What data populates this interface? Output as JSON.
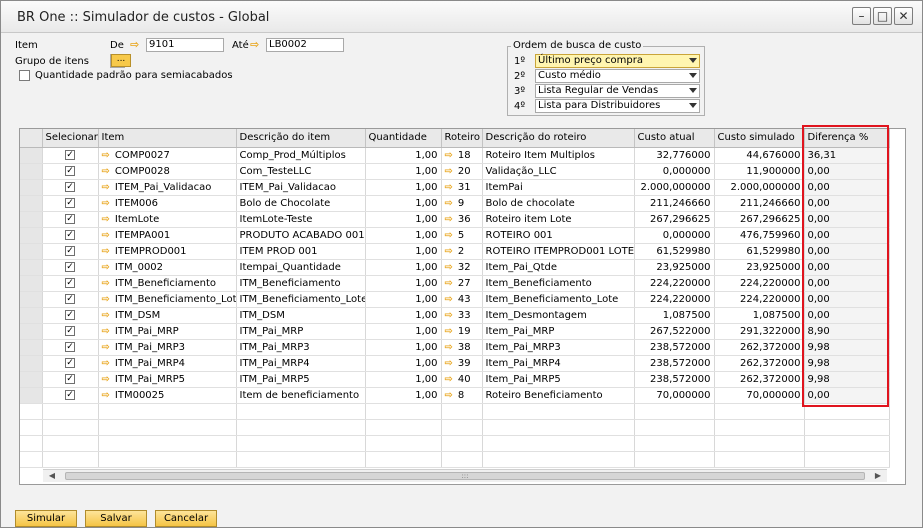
{
  "window": {
    "title": "BR One :: Simulador de custos - Global",
    "minimize_icon": "minimize-icon",
    "maximize_icon": "maximize-icon",
    "close_icon": "close-icon"
  },
  "filters": {
    "item_label": "Item",
    "de_label": "De",
    "de_value": "9101",
    "ate_label": "Até",
    "ate_value": "LB0002",
    "grupo_label": "Grupo de itens",
    "grupo_button": "...",
    "qtd_padrao_label": "Quantidade padrão para semiacabados",
    "qtd_padrao_checked": false
  },
  "ordem": {
    "title": "Ordem de busca de custo",
    "items": [
      {
        "num": "1º",
        "value": "Último preço compra"
      },
      {
        "num": "2º",
        "value": "Custo médio"
      },
      {
        "num": "3º",
        "value": "Lista Regular de Vendas"
      },
      {
        "num": "4º",
        "value": "Lista para Distribuidores"
      }
    ]
  },
  "grid": {
    "columns": [
      "Selecionar",
      "Item",
      "Descrição do item",
      "Quantidade",
      "Roteiro",
      "Descrição do roteiro",
      "Custo atual",
      "Custo simulado",
      "Diferença %"
    ],
    "rows": [
      [
        "✓",
        "COMP0027",
        "Comp_Prod_Múltiplos",
        "1,00",
        "18",
        "Roteiro Item Multiplos",
        "32,776000",
        "44,676000",
        "36,31"
      ],
      [
        "✓",
        "COMP0028",
        "Com_TesteLLC",
        "1,00",
        "20",
        "Validação_LLC",
        "0,000000",
        "11,900000",
        "0,00"
      ],
      [
        "✓",
        "ITEM_Pai_Validacao",
        "ITEM_Pai_Validacao",
        "1,00",
        "31",
        "ItemPai",
        "2.000,000000",
        "2.000,000000",
        "0,00"
      ],
      [
        "✓",
        "ITEM006",
        "Bolo de Chocolate",
        "1,00",
        "9",
        "Bolo de chocolate",
        "211,246660",
        "211,246660",
        "0,00"
      ],
      [
        "✓",
        "ItemLote",
        "ItemLote-Teste",
        "1,00",
        "36",
        "Roteiro item Lote",
        "267,296625",
        "267,296625",
        "0,00"
      ],
      [
        "✓",
        "ITEMPA001",
        "PRODUTO ACABADO 001",
        "1,00",
        "5",
        "ROTEIRO 001",
        "0,000000",
        "476,759960",
        "0,00"
      ],
      [
        "✓",
        "ITEMPROD001",
        "ITEM PROD 001",
        "1,00",
        "2",
        "ROTEIRO ITEMPROD001 LOTE",
        "61,529980",
        "61,529980",
        "0,00"
      ],
      [
        "✓",
        "ITM_0002",
        "Itempai_Quantidade",
        "1,00",
        "32",
        "Item_Pai_Qtde",
        "23,925000",
        "23,925000",
        "0,00"
      ],
      [
        "✓",
        "ITM_Beneficiamento",
        "ITM_Beneficiamento",
        "1,00",
        "27",
        "Item_Beneficiamento",
        "224,220000",
        "224,220000",
        "0,00"
      ],
      [
        "✓",
        "ITM_Beneficiamento_Lote",
        "ITM_Beneficiamento_Lote",
        "1,00",
        "43",
        "Item_Beneficiamento_Lote",
        "224,220000",
        "224,220000",
        "0,00"
      ],
      [
        "✓",
        "ITM_DSM",
        "ITM_DSM",
        "1,00",
        "33",
        "Item_Desmontagem",
        "1,087500",
        "1,087500",
        "0,00"
      ],
      [
        "✓",
        "ITM_Pai_MRP",
        "ITM_Pai_MRP",
        "1,00",
        "19",
        "Item_Pai_MRP",
        "267,522000",
        "291,322000",
        "8,90"
      ],
      [
        "✓",
        "ITM_Pai_MRP3",
        "ITM_Pai_MRP3",
        "1,00",
        "38",
        "Item_Pai_MRP3",
        "238,572000",
        "262,372000",
        "9,98"
      ],
      [
        "✓",
        "ITM_Pai_MRP4",
        "ITM_Pai_MRP4",
        "1,00",
        "39",
        "Item_Pai_MRP4",
        "238,572000",
        "262,372000",
        "9,98"
      ],
      [
        "✓",
        "ITM_Pai_MRP5",
        "ITM_Pai_MRP5",
        "1,00",
        "40",
        "Item_Pai_MRP5",
        "238,572000",
        "262,372000",
        "9,98"
      ],
      [
        "✓",
        "ITM00025",
        "Item de beneficiamento",
        "1,00",
        "8",
        "Roteiro Beneficiamento",
        "70,000000",
        "70,000000",
        "0,00"
      ]
    ]
  },
  "scrollbar_grip": ":::",
  "buttons": {
    "simular": "Simular",
    "salvar": "Salvar",
    "cancelar": "Cancelar"
  },
  "colors": {
    "highlight": "#e0141e",
    "link_arrow": "#e8a316",
    "button": "#f5c445"
  }
}
